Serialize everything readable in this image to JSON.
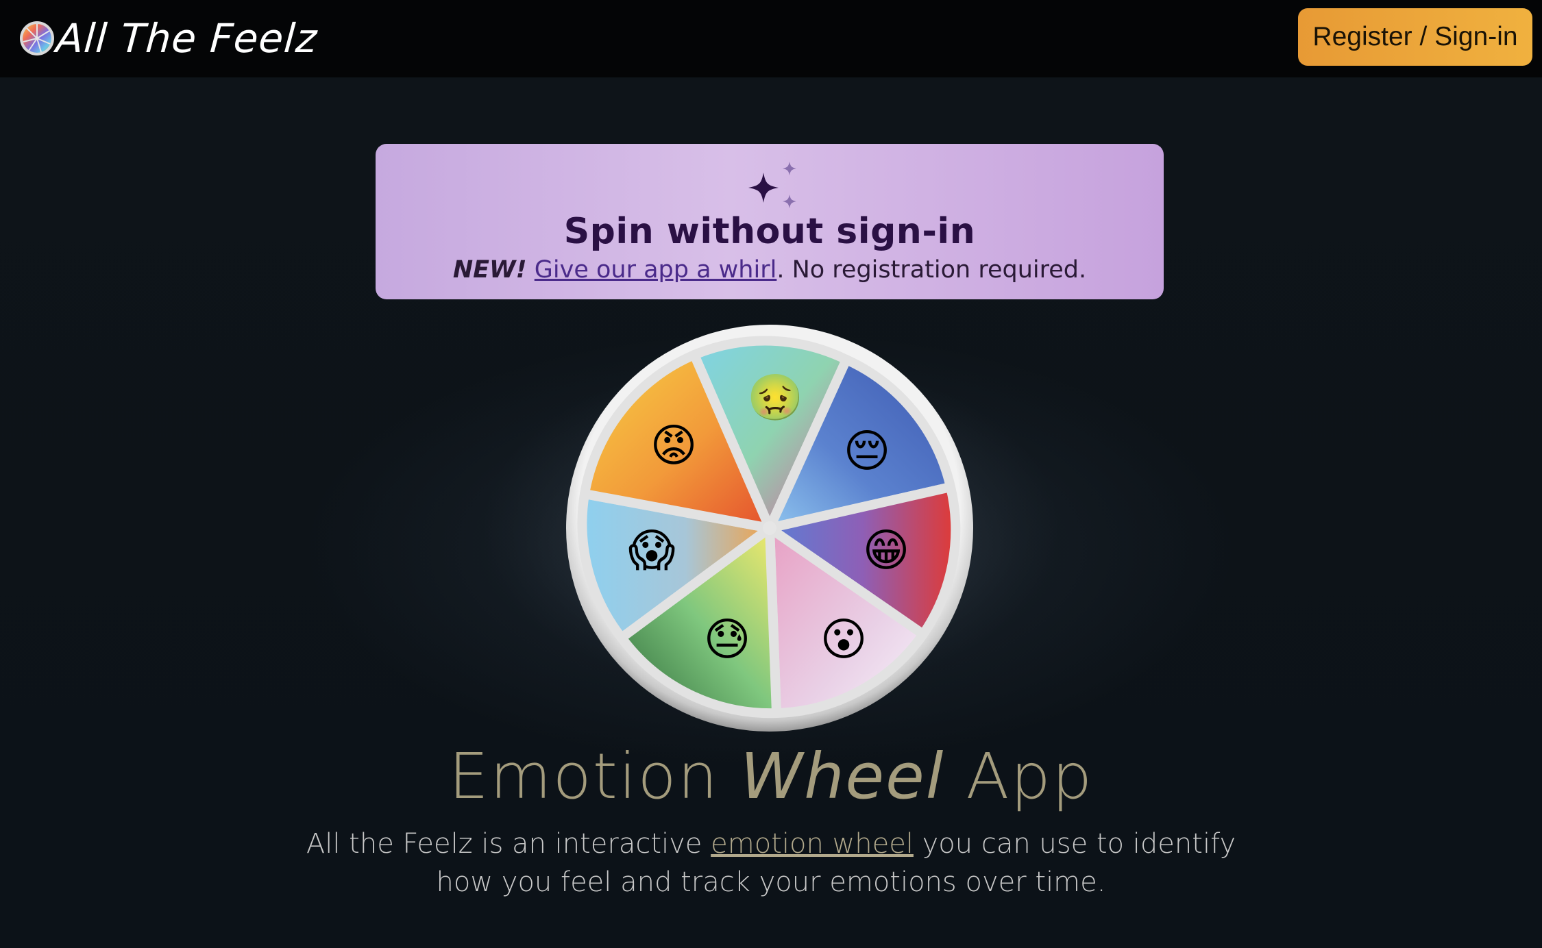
{
  "header": {
    "brand_name": "All The Feelz",
    "signin_label": "Register / Sign-in"
  },
  "promo": {
    "icon": "sparkle-icon",
    "title": "Spin without sign-in",
    "new_label": "NEW!",
    "link_text": "Give our app a whirl",
    "trailing_text": ". No registration required."
  },
  "wheel": {
    "segments": [
      {
        "emotion": "disgust",
        "emoji": "🤢"
      },
      {
        "emotion": "sad",
        "emoji": "😔"
      },
      {
        "emotion": "happy",
        "emoji": "😁"
      },
      {
        "emotion": "surprise",
        "emoji": "😮"
      },
      {
        "emotion": "tired",
        "emoji": "😓"
      },
      {
        "emotion": "fear",
        "emoji": "😱"
      },
      {
        "emotion": "anger",
        "emoji": "😡"
      }
    ]
  },
  "hero": {
    "title_part1": "Emotion ",
    "title_part2": "Wheel",
    "title_part3": " App",
    "desc_before": "All the Feelz is an interactive ",
    "desc_link": "emotion wheel",
    "desc_after": " you can use to identify how you feel and track your emotions over time."
  }
}
